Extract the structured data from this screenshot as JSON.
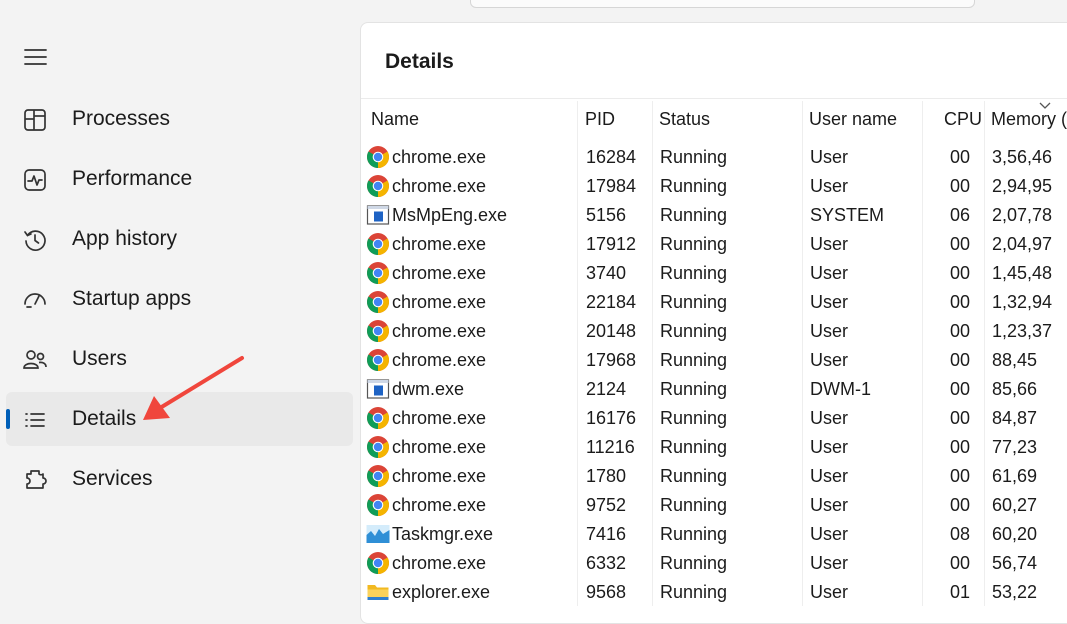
{
  "sidebar": {
    "items": [
      {
        "label": "Processes",
        "icon": "processes-icon",
        "active": false
      },
      {
        "label": "Performance",
        "icon": "performance-icon",
        "active": false
      },
      {
        "label": "App history",
        "icon": "app-history-icon",
        "active": false
      },
      {
        "label": "Startup apps",
        "icon": "startup-apps-icon",
        "active": false
      },
      {
        "label": "Users",
        "icon": "users-icon",
        "active": false
      },
      {
        "label": "Details",
        "icon": "details-icon",
        "active": true
      },
      {
        "label": "Services",
        "icon": "services-icon",
        "active": false
      }
    ]
  },
  "details": {
    "title": "Details",
    "columns": {
      "name": "Name",
      "pid": "PID",
      "status": "Status",
      "user": "User name",
      "cpu": "CPU",
      "memory": "Memory ("
    },
    "rows": [
      {
        "icon": "chrome-icon",
        "name": "chrome.exe",
        "pid": "16284",
        "status": "Running",
        "user": "User",
        "cpu": "00",
        "memory": "3,56,46"
      },
      {
        "icon": "chrome-icon",
        "name": "chrome.exe",
        "pid": "17984",
        "status": "Running",
        "user": "User",
        "cpu": "00",
        "memory": "2,94,95"
      },
      {
        "icon": "app-window-icon",
        "name": "MsMpEng.exe",
        "pid": "5156",
        "status": "Running",
        "user": "SYSTEM",
        "cpu": "06",
        "memory": "2,07,78"
      },
      {
        "icon": "chrome-icon",
        "name": "chrome.exe",
        "pid": "17912",
        "status": "Running",
        "user": "User",
        "cpu": "00",
        "memory": "2,04,97"
      },
      {
        "icon": "chrome-icon",
        "name": "chrome.exe",
        "pid": "3740",
        "status": "Running",
        "user": "User",
        "cpu": "00",
        "memory": "1,45,48"
      },
      {
        "icon": "chrome-icon",
        "name": "chrome.exe",
        "pid": "22184",
        "status": "Running",
        "user": "User",
        "cpu": "00",
        "memory": "1,32,94"
      },
      {
        "icon": "chrome-icon",
        "name": "chrome.exe",
        "pid": "20148",
        "status": "Running",
        "user": "User",
        "cpu": "00",
        "memory": "1,23,37"
      },
      {
        "icon": "chrome-icon",
        "name": "chrome.exe",
        "pid": "17968",
        "status": "Running",
        "user": "User",
        "cpu": "00",
        "memory": "88,45"
      },
      {
        "icon": "app-window-icon",
        "name": "dwm.exe",
        "pid": "2124",
        "status": "Running",
        "user": "DWM-1",
        "cpu": "00",
        "memory": "85,66"
      },
      {
        "icon": "chrome-icon",
        "name": "chrome.exe",
        "pid": "16176",
        "status": "Running",
        "user": "User",
        "cpu": "00",
        "memory": "84,87"
      },
      {
        "icon": "chrome-icon",
        "name": "chrome.exe",
        "pid": "11216",
        "status": "Running",
        "user": "User",
        "cpu": "00",
        "memory": "77,23"
      },
      {
        "icon": "chrome-icon",
        "name": "chrome.exe",
        "pid": "1780",
        "status": "Running",
        "user": "User",
        "cpu": "00",
        "memory": "61,69"
      },
      {
        "icon": "chrome-icon",
        "name": "chrome.exe",
        "pid": "9752",
        "status": "Running",
        "user": "User",
        "cpu": "00",
        "memory": "60,27"
      },
      {
        "icon": "taskmgr-icon",
        "name": "Taskmgr.exe",
        "pid": "7416",
        "status": "Running",
        "user": "User",
        "cpu": "08",
        "memory": "60,20"
      },
      {
        "icon": "chrome-icon",
        "name": "chrome.exe",
        "pid": "6332",
        "status": "Running",
        "user": "User",
        "cpu": "00",
        "memory": "56,74"
      },
      {
        "icon": "folder-icon",
        "name": "explorer.exe",
        "pid": "9568",
        "status": "Running",
        "user": "User",
        "cpu": "01",
        "memory": "53,22"
      }
    ]
  },
  "colors": {
    "accent": "#005fb8",
    "arrow": "#f0463c",
    "active_nav_bg": "#e9e9e9"
  }
}
